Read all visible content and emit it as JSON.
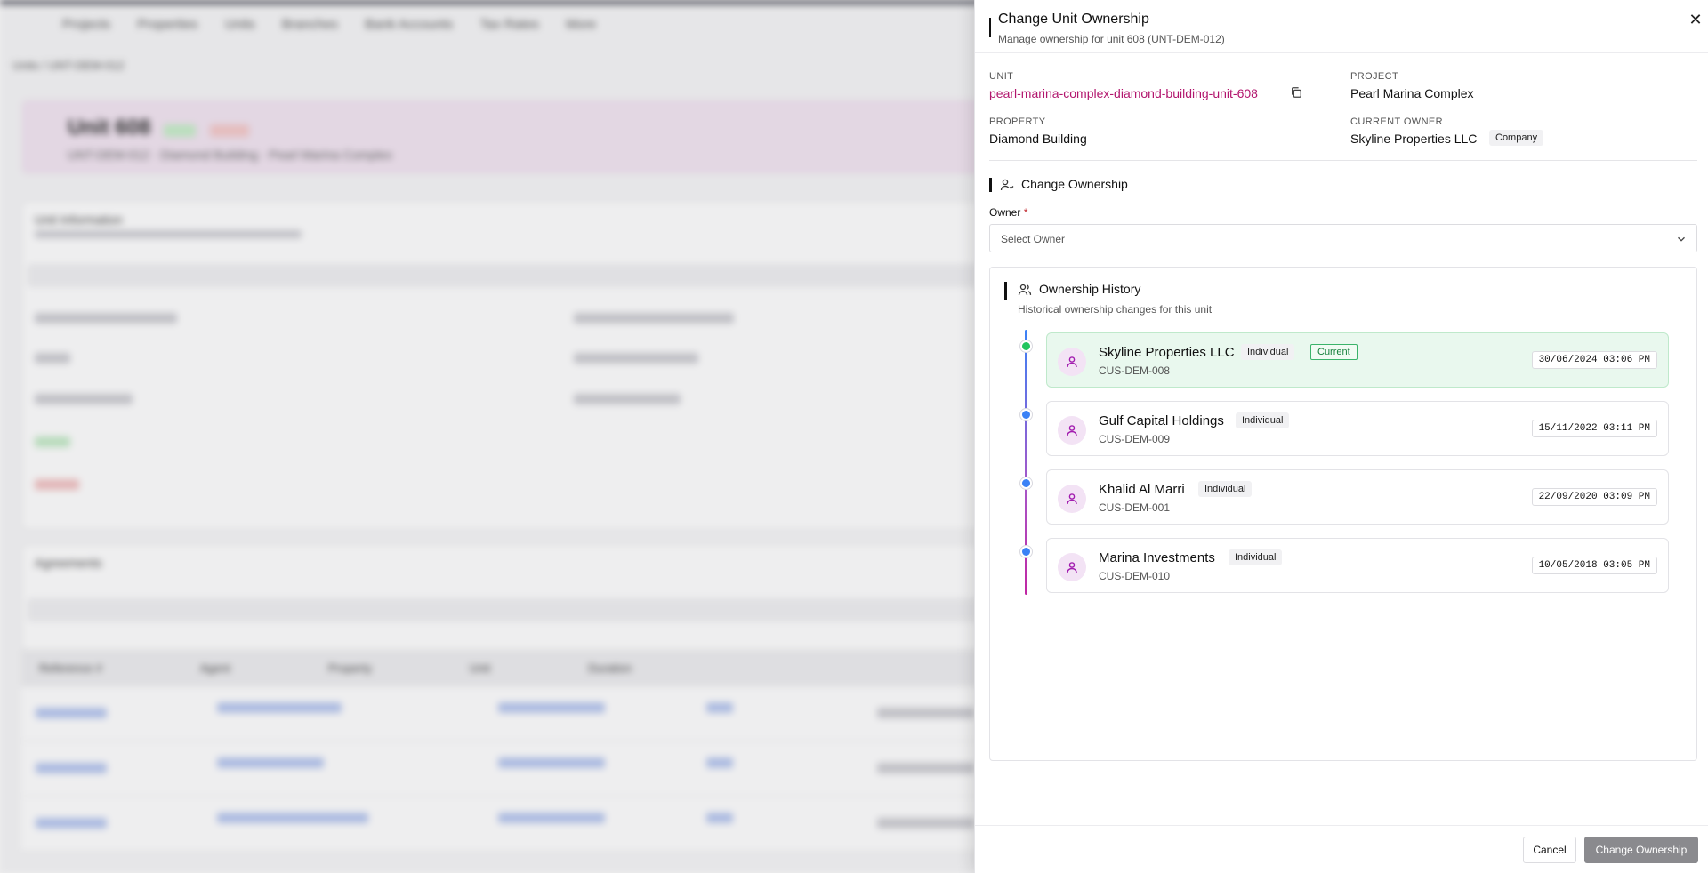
{
  "background": {
    "nav": [
      "Projects",
      "Properties",
      "Units",
      "Branches",
      "Bank Accounts",
      "Tax Rates",
      "More"
    ],
    "breadcrumb": "Units / UNT-DEM-012",
    "unit_title": "Unit 608",
    "unit_sub": "UNT-DEM-012 · Diamond Building · Pearl Marina Complex",
    "unit_info_title": "Unit Information",
    "agreements_title": "Agreements",
    "table_headers": [
      "Reference #",
      "Agent",
      "Property",
      "Unit",
      "Duration"
    ]
  },
  "panel": {
    "title": "Change Unit Ownership",
    "subtitle": "Manage ownership for unit 608 (UNT-DEM-012)",
    "close_glyph": "✕",
    "unit_label": "UNIT",
    "unit_value": "pearl-marina-complex-diamond-building-unit-608",
    "project_label": "PROJECT",
    "project_value": "Pearl Marina Complex",
    "property_label": "PROPERTY",
    "property_value": "Diamond Building",
    "owner_label": "CURRENT OWNER",
    "owner_value": "Skyline Properties LLC",
    "owner_type": "Company",
    "section_title": "Change Ownership",
    "field_label": "Owner",
    "required_mark": "*",
    "select_placeholder": "Select Owner",
    "history_title": "Ownership History",
    "history_sub": "Historical ownership changes for this unit",
    "current_badge": "Current",
    "entries": [
      {
        "name": "Skyline Properties LLC",
        "code": "CUS-DEM-008",
        "type": "Individual",
        "date": "30/06/2024 03:06 PM",
        "current": true
      },
      {
        "name": "Gulf Capital Holdings",
        "code": "CUS-DEM-009",
        "type": "Individual",
        "date": "15/11/2022 03:11 PM",
        "current": false
      },
      {
        "name": "Khalid Al Marri",
        "code": "CUS-DEM-001",
        "type": "Individual",
        "date": "22/09/2020 03:09 PM",
        "current": false
      },
      {
        "name": "Marina Investments",
        "code": "CUS-DEM-010",
        "type": "Individual",
        "date": "10/05/2018 03:05 PM",
        "current": false
      }
    ],
    "cancel_label": "Cancel",
    "submit_label": "Change Ownership"
  },
  "colors": {
    "link": "#b2156d",
    "current_dot": "#22c55e",
    "history_dot": "#3b82f6",
    "submit_bg": "#8a8a8e"
  }
}
